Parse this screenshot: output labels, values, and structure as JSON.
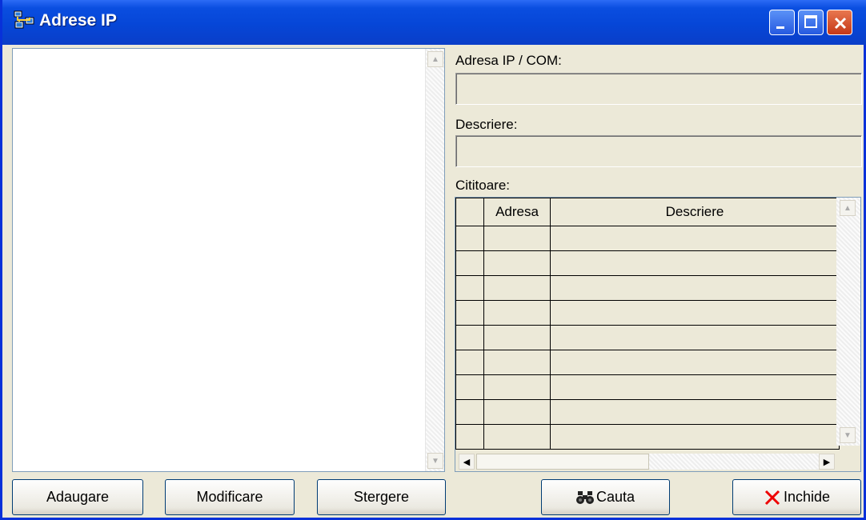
{
  "window": {
    "title": "Adrese IP",
    "icon": "network-icon"
  },
  "form": {
    "address_label": "Adresa IP / COM:",
    "address_value": "",
    "description_label": "Descriere:",
    "description_value": "",
    "readers_label": "Cititoare:"
  },
  "grid": {
    "columns": [
      "",
      "Adresa",
      "Descriere"
    ],
    "rows": [
      [
        "",
        "",
        ""
      ],
      [
        "",
        "",
        ""
      ],
      [
        "",
        "",
        ""
      ],
      [
        "",
        "",
        ""
      ],
      [
        "",
        "",
        ""
      ],
      [
        "",
        "",
        ""
      ],
      [
        "",
        "",
        ""
      ],
      [
        "",
        "",
        ""
      ],
      [
        "",
        "",
        ""
      ]
    ]
  },
  "buttons": {
    "add": "Adaugare",
    "modify": "Modificare",
    "delete": "Stergere",
    "search": "Cauta",
    "close": "Inchide"
  },
  "icons": {
    "search": "binoculars-icon",
    "close": "red-x-icon"
  }
}
